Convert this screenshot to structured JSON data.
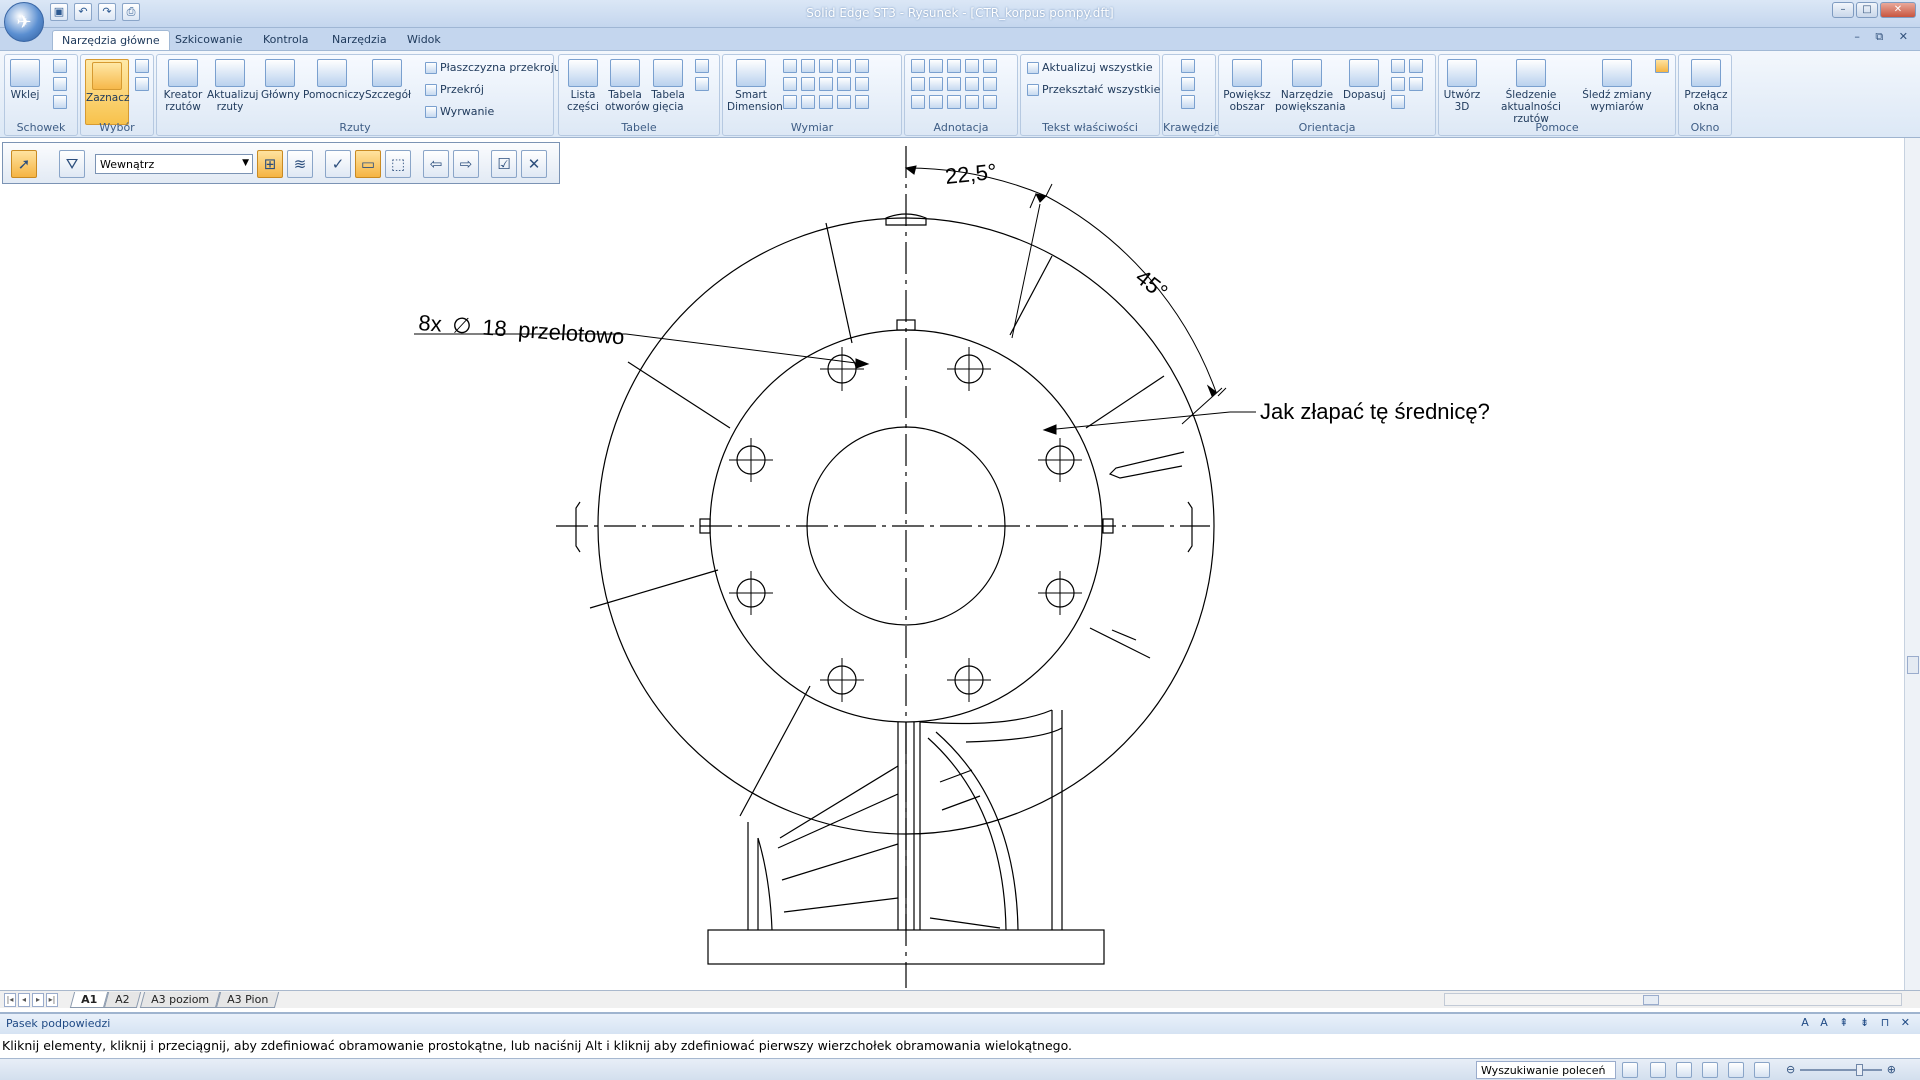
{
  "window": {
    "title": "Solid Edge ST3 - Rysunek - [CTR_korpus pompy.dft]",
    "controls_app": [
      "–",
      "□",
      "✕"
    ],
    "controls_doc": [
      "–",
      "⧉",
      "✕"
    ]
  },
  "ribbon_tabs": [
    "Narzędzia główne",
    "Szkicowanie",
    "Kontrola",
    "Narzędzia",
    "Widok"
  ],
  "groups": {
    "schowek": {
      "label": "Schowek",
      "paste": "Wklej"
    },
    "wybor": {
      "label": "Wybór",
      "select": "Zaznacz"
    },
    "rzuty": {
      "label": "Rzuty",
      "kreator": "Kreator rzutów",
      "aktualizuj": "Aktualizuj rzuty",
      "glowny": "Główny",
      "pomocniczy": "Pomocniczy",
      "szczegol": "Szczegół",
      "plaszczyzna": "Płaszczyzna przekroju",
      "przekroj": "Przekrój",
      "wyrwanie": "Wyrwanie"
    },
    "tabele": {
      "label": "Tabele",
      "lista": "Lista części",
      "otworow": "Tabela otworów",
      "giecia": "Tabela gięcia"
    },
    "wymiar": {
      "label": "Wymiar",
      "smart": "Smart Dimension"
    },
    "adnotacja": {
      "label": "Adnotacja"
    },
    "tekst": {
      "label": "Tekst właściwości",
      "aktualizuj": "Aktualizuj wszystkie",
      "przeksztalc": "Przekształć wszystkie"
    },
    "krawedzie": {
      "label": "Krawędzie"
    },
    "orientacja": {
      "label": "Orientacja",
      "powieksz": "Powiększ obszar",
      "narzedzie": "Narzędzie powiększania",
      "dopasuj": "Dopasuj"
    },
    "pomoce": {
      "label": "Pomoce",
      "utworz3d": "Utwórz 3D",
      "sledzenie": "Śledzenie aktualności rzutów",
      "sledz": "Śledź zmiany wymiarów"
    },
    "okno": {
      "label": "Okno",
      "przelacz": "Przełącz okna"
    }
  },
  "select_toolbar": {
    "mode": "Wewnątrz"
  },
  "drawing": {
    "angle1": "22,5°",
    "angle2": "45°",
    "hole_callout_prefix": "8x",
    "hole_callout_symbol": "∅",
    "hole_callout_value": "18",
    "hole_callout_suffix": "przelotowo",
    "question": "Jak złapać tę średnicę?"
  },
  "sheets": [
    "A1",
    "A2",
    "A3 poziom",
    "A3 Pion"
  ],
  "hint": {
    "title": "Pasek podpowiedzi",
    "text": "Kliknij elementy, kliknij i przeciągnij, aby zdefiniować obramowanie prostokątne, lub naciśnij Alt i kliknij aby zdefiniować pierwszy wierzchołek obramowania wielokątnego."
  },
  "status": {
    "search_placeholder": "Wyszukiwanie poleceń"
  }
}
